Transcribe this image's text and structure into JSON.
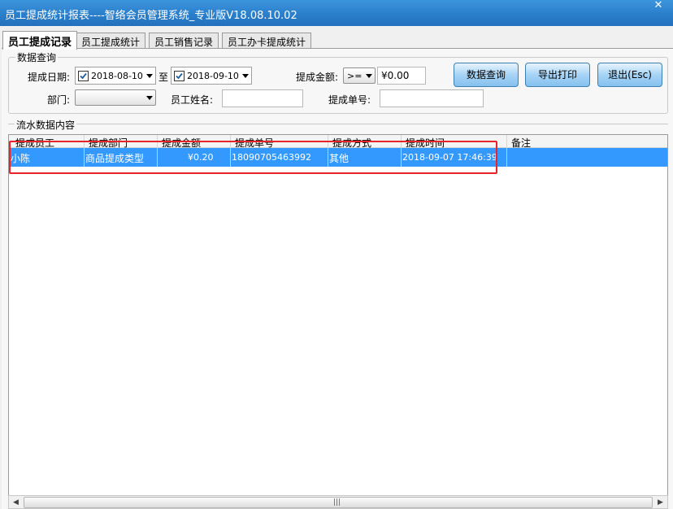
{
  "window": {
    "title": "员工提成统计报表----智络会员管理系统_专业版V18.08.10.02",
    "close_glyph": "✕"
  },
  "tabs": [
    {
      "label": "员工提成记录",
      "active": true
    },
    {
      "label": "员工提成统计",
      "active": false
    },
    {
      "label": "员工销售记录",
      "active": false
    },
    {
      "label": "员工办卡提成统计",
      "active": false
    }
  ],
  "query": {
    "group_label": "数据查询",
    "date_label": "提成日期:",
    "date_from": "2018-08-10",
    "date_to_label": "至",
    "date_to": "2018-09-10",
    "amount_label": "提成金额:",
    "amount_operator": ">=",
    "amount_value": "¥0.00",
    "dept_label": "部门:",
    "dept_value": "",
    "name_label": "员工姓名:",
    "name_value": "",
    "order_label": "提成单号:",
    "order_value": "",
    "btn_query": "数据查询",
    "btn_export": "导出打印",
    "btn_exit": "退出(Esc)"
  },
  "grid": {
    "group_label": "流水数据内容",
    "columns": [
      "提成员工",
      "提成部门",
      "提成金额",
      "提成单号",
      "提成方式",
      "提成时间",
      "备注"
    ],
    "rows": [
      {
        "employee": "小陈",
        "dept": "商品提成类型",
        "amount": "¥0.20",
        "order_no": "18090705463992",
        "method": "其他",
        "time": "2018-09-07 17:46:39",
        "note": ""
      }
    ]
  },
  "colors": {
    "title_bar": "#2a7fcb",
    "row_selected": "#3399ff",
    "highlight_box": "#e8232a",
    "button": "#a6d3f5"
  }
}
